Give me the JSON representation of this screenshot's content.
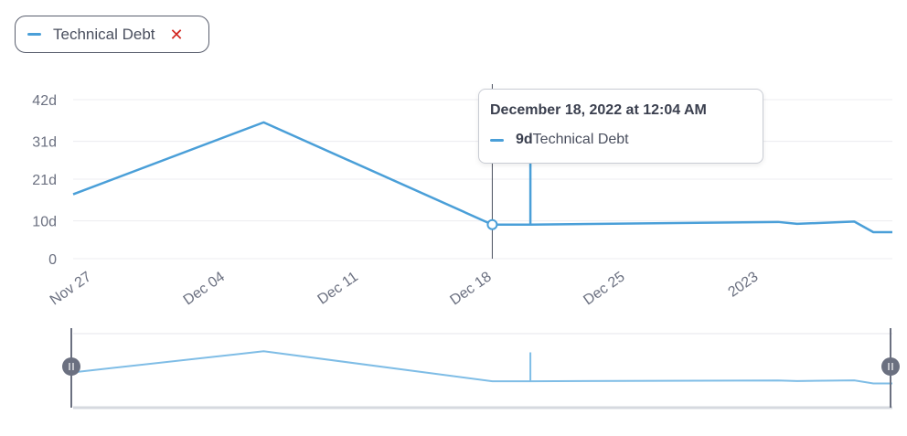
{
  "legend": {
    "label": "Technical Debt",
    "remove_glyph": "✕",
    "color": "#4a9fd8"
  },
  "tooltip": {
    "title": "December 18, 2022 at 12:04 AM",
    "value": "9d",
    "series": "Technical Debt"
  },
  "chart_data": {
    "type": "line",
    "x_axis": "date",
    "y_unit": "d",
    "ylim": [
      0,
      42
    ],
    "y_ticks": [
      {
        "value": 0,
        "label": "0"
      },
      {
        "value": 10,
        "label": "10d"
      },
      {
        "value": 21,
        "label": "21d"
      },
      {
        "value": 31,
        "label": "31d"
      },
      {
        "value": 42,
        "label": "42d"
      }
    ],
    "x_ticks": [
      {
        "date": "2022-11-27",
        "label": "Nov 27"
      },
      {
        "date": "2022-12-04",
        "label": "Dec 04"
      },
      {
        "date": "2022-12-11",
        "label": "Dec 11"
      },
      {
        "date": "2022-12-18",
        "label": "Dec 18"
      },
      {
        "date": "2022-12-25",
        "label": "Dec 25"
      },
      {
        "date": "2023-01-01",
        "label": "2023"
      }
    ],
    "xlim": [
      "2022-11-26",
      "2023-01-08"
    ],
    "grid": true,
    "highlight": {
      "x": "2022-12-18",
      "y": 9
    },
    "series": [
      {
        "name": "Technical Debt",
        "color": "#4a9fd8",
        "points": [
          {
            "x": "2022-11-26",
            "y": 17
          },
          {
            "x": "2022-12-06",
            "y": 36
          },
          {
            "x": "2022-12-18",
            "y": 9
          },
          {
            "x": "2022-12-20",
            "y": 9
          },
          {
            "x": "2022-12-20",
            "y": 35
          },
          {
            "x": "2022-12-20",
            "y": 9
          },
          {
            "x": "2023-01-02",
            "y": 9.7
          },
          {
            "x": "2023-01-03",
            "y": 9.2
          },
          {
            "x": "2023-01-06",
            "y": 9.8
          },
          {
            "x": "2023-01-07",
            "y": 7
          },
          {
            "x": "2023-01-08",
            "y": 7
          }
        ]
      }
    ]
  }
}
